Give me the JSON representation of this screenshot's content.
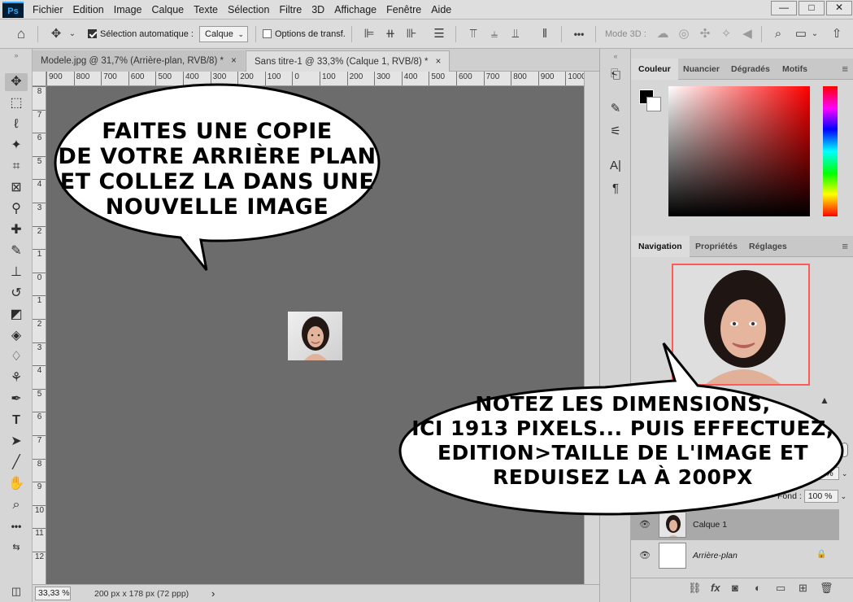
{
  "menubar": {
    "logo": "Ps",
    "items": [
      "Fichier",
      "Edition",
      "Image",
      "Calque",
      "Texte",
      "Sélection",
      "Filtre",
      "3D",
      "Affichage",
      "Fenêtre",
      "Aide"
    ],
    "win_min": "—",
    "win_max": "□",
    "win_close": "✕"
  },
  "options": {
    "auto_select_label": "Sélection automatique :",
    "auto_select_checked": true,
    "calque_value": "Calque",
    "transform_label": "Options de transf.",
    "mode3d_label": "Mode 3D :",
    "more": "•••"
  },
  "tabs": [
    {
      "label": "Modele.jpg @ 31,7% (Arrière-plan, RVB/8) *",
      "close": "×"
    },
    {
      "label": "Sans titre-1 @ 33,3% (Calque 1, RVB/8) *",
      "close": "×"
    }
  ],
  "ruler": {
    "h_labels": [
      "900",
      "800",
      "700",
      "600",
      "500",
      "400",
      "300",
      "200",
      "100",
      "0",
      "100",
      "200",
      "300",
      "400",
      "500",
      "600",
      "700",
      "800",
      "900",
      "1000"
    ],
    "v_labels": [
      "8",
      "7",
      "6",
      "5",
      "4",
      "3",
      "2",
      "1",
      "0",
      "1",
      "2",
      "3",
      "4",
      "5",
      "6",
      "7",
      "8",
      "9",
      "10",
      "11",
      "12"
    ]
  },
  "status": {
    "zoom": "33,33 %",
    "docinfo": "200 px x 178 px (72 ppp)",
    "arrow": "›"
  },
  "panels": {
    "color_tabs": [
      "Couleur",
      "Nuancier",
      "Dégradés",
      "Motifs"
    ],
    "nav_tabs": [
      "Navigation",
      "Propriétés",
      "Réglages"
    ],
    "opacity_value": "100 %",
    "fill_label": "Fond :",
    "fill_value": "100 %",
    "layers": [
      {
        "name": "Calque 1"
      },
      {
        "name": "Arrière-plan",
        "lock": "🔒"
      }
    ]
  },
  "bubbles": {
    "top": [
      "Faites une copie",
      "de votre arrière plan",
      "et collez la dans une",
      "nouvelle image"
    ],
    "bottom": [
      "Notez les dimensions,",
      "ici 1913 pixels... puis effectuez,",
      "edition>taille de l'image et",
      "reduisez la à 200px"
    ]
  },
  "colors": {
    "canvas": "#6c6c6c",
    "nav_frame": "#ff5a5a",
    "ps_blue": "#31a8ff"
  }
}
